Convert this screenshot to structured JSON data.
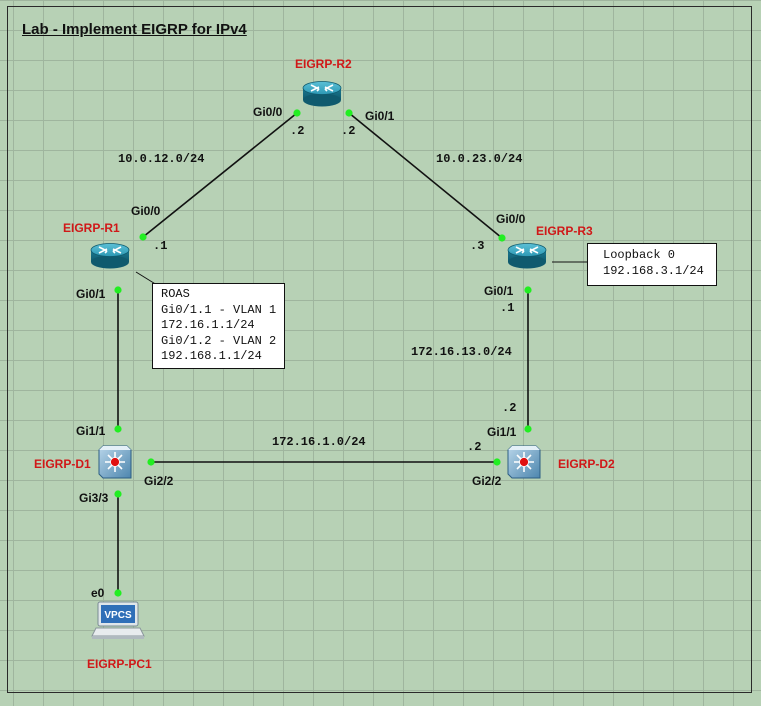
{
  "title": "Lab - Implement EIGRP for IPv4",
  "devices": {
    "r1": "EIGRP-R1",
    "r2": "EIGRP-R2",
    "r3": "EIGRP-R3",
    "d1": "EIGRP-D1",
    "d2": "EIGRP-D2",
    "pc1": "EIGRP-PC1"
  },
  "pc_icon_text": "VPCS",
  "interfaces": {
    "r1_gi0_0": "Gi0/0",
    "r1_gi0_1": "Gi0/1",
    "r2_gi0_0": "Gi0/0",
    "r2_gi0_1": "Gi0/1",
    "r3_gi0_0": "Gi0/0",
    "r3_gi0_1": "Gi0/1",
    "d1_gi1_1": "Gi1/1",
    "d1_gi2_2": "Gi2/2",
    "d1_gi3_3": "Gi3/3",
    "d2_gi1_1": "Gi1/1",
    "d2_gi2_2": "Gi2/2",
    "pc1_e0": "e0"
  },
  "hosts": {
    "r1_gi0_0": ".1",
    "r2_gi0_0": ".2",
    "r2_gi0_1": ".2",
    "r3_gi0_0": ".3",
    "r3_gi0_1": ".1",
    "d2_gi1_1": ".2",
    "d2_gi2_2": ".2"
  },
  "networks": {
    "r1_r2": "10.0.12.0/24",
    "r2_r3": "10.0.23.0/24",
    "r3_d2": "172.16.13.0/24",
    "d1_d2": "172.16.1.0/24"
  },
  "notes": {
    "roas": [
      "ROAS",
      "Gi0/1.1 - VLAN 1",
      "172.16.1.1/24",
      "Gi0/1.2 - VLAN 2",
      "192.168.1.1/24"
    ],
    "loopback": [
      "Loopback 0",
      "192.168.3.1/24"
    ]
  },
  "colors": {
    "canvas": "#b7d1b5",
    "grid": "#9fb59e",
    "device_label": "#d01818",
    "port_dot": "#22ee22",
    "router": "#1e88a0"
  }
}
